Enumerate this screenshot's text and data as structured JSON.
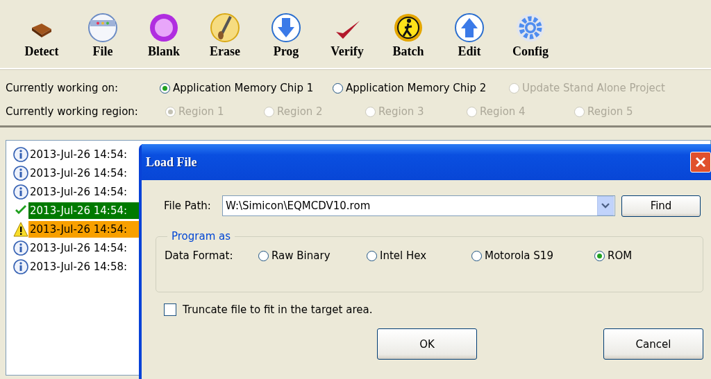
{
  "toolbar": [
    {
      "label": "Detect"
    },
    {
      "label": "File"
    },
    {
      "label": "Blank"
    },
    {
      "label": "Erase"
    },
    {
      "label": "Prog"
    },
    {
      "label": "Verify"
    },
    {
      "label": "Batch"
    },
    {
      "label": "Edit"
    },
    {
      "label": "Config"
    }
  ],
  "working_on": {
    "label": "Currently working on:",
    "options": [
      {
        "label": "Application Memory Chip 1",
        "selected": true,
        "disabled": false
      },
      {
        "label": "Application Memory Chip 2",
        "selected": false,
        "disabled": false
      },
      {
        "label": "Update Stand Alone Project",
        "selected": false,
        "disabled": true
      }
    ]
  },
  "working_region": {
    "label": "Currently working region:",
    "options": [
      {
        "label": "Region 1",
        "selected": true,
        "disabled": true
      },
      {
        "label": "Region 2",
        "selected": false,
        "disabled": true
      },
      {
        "label": "Region 3",
        "selected": false,
        "disabled": true
      },
      {
        "label": "Region 4",
        "selected": false,
        "disabled": true
      },
      {
        "label": "Region 5",
        "selected": false,
        "disabled": true
      }
    ]
  },
  "log": [
    {
      "kind": "info",
      "text": "2013-Jul-26 14:54:"
    },
    {
      "kind": "info",
      "text": "2013-Jul-26 14:54:"
    },
    {
      "kind": "info",
      "text": "2013-Jul-26 14:54:"
    },
    {
      "kind": "success",
      "text": "2013-Jul-26 14:54:"
    },
    {
      "kind": "warning",
      "text": "2013-Jul-26 14:54:"
    },
    {
      "kind": "info",
      "text": "2013-Jul-26 14:54:"
    },
    {
      "kind": "info",
      "text": "2013-Jul-26 14:58:"
    }
  ],
  "dialog": {
    "title": "Load File",
    "file_path": {
      "label": "File Path:",
      "value": "W:\\Simicon\\EQMCDV10.rom"
    },
    "find_button": "Find",
    "group": {
      "title": "Program as",
      "label": "Data Format:",
      "options": [
        {
          "label": "Raw Binary",
          "selected": false
        },
        {
          "label": "Intel Hex",
          "selected": false
        },
        {
          "label": "Motorola S19",
          "selected": false
        },
        {
          "label": "ROM",
          "selected": true
        }
      ]
    },
    "truncate": {
      "label": "Truncate file to fit in the target area.",
      "checked": false
    },
    "buttons": [
      "OK",
      "Cancel"
    ]
  }
}
